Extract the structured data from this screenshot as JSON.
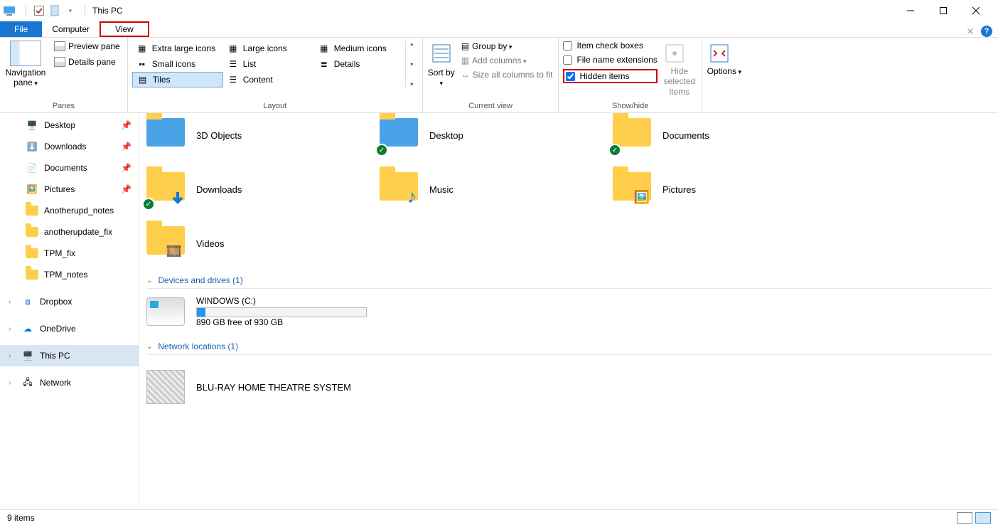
{
  "window": {
    "title": "This PC"
  },
  "ribbon_tabs": {
    "file": "File",
    "computer": "Computer",
    "view": "View"
  },
  "ribbon": {
    "panes": {
      "nav": "Navigation pane",
      "preview": "Preview pane",
      "details": "Details pane",
      "group": "Panes"
    },
    "layout": {
      "extra_large": "Extra large icons",
      "large": "Large icons",
      "medium": "Medium icons",
      "small": "Small icons",
      "list": "List",
      "details": "Details",
      "tiles": "Tiles",
      "content": "Content",
      "group": "Layout"
    },
    "current_view": {
      "sort_by": "Sort by",
      "group_by": "Group by",
      "add_columns": "Add columns",
      "size_all": "Size all columns to fit",
      "group": "Current view"
    },
    "show_hide": {
      "item_check": "Item check boxes",
      "file_ext": "File name extensions",
      "hidden": "Hidden items",
      "hide_selected": "Hide selected items",
      "group": "Show/hide"
    },
    "options": {
      "label": "Options"
    }
  },
  "nav": {
    "items": [
      {
        "label": "Desktop",
        "icon": "desktop",
        "pin": true
      },
      {
        "label": "Downloads",
        "icon": "downloads",
        "pin": true
      },
      {
        "label": "Documents",
        "icon": "documents",
        "pin": true
      },
      {
        "label": "Pictures",
        "icon": "pictures",
        "pin": true
      },
      {
        "label": "Anotherupd_notes",
        "icon": "folder",
        "pin": false
      },
      {
        "label": "anotherupdate_fix",
        "icon": "folder",
        "pin": false
      },
      {
        "label": "TPM_fix",
        "icon": "folder",
        "pin": false
      },
      {
        "label": "TPM_notes",
        "icon": "folder",
        "pin": false
      }
    ],
    "dropbox": "Dropbox",
    "onedrive": "OneDrive",
    "this_pc": "This PC",
    "network": "Network"
  },
  "content": {
    "folders_row1": [
      {
        "label": "3D Objects",
        "sync": false
      },
      {
        "label": "Desktop",
        "sync": true
      },
      {
        "label": "Documents",
        "sync": true
      }
    ],
    "folders_row2": [
      {
        "label": "Downloads",
        "sync": true
      },
      {
        "label": "Music",
        "sync": false
      },
      {
        "label": "Pictures",
        "sync": false
      }
    ],
    "folders_row3": [
      {
        "label": "Videos",
        "sync": false
      }
    ],
    "devices_header": "Devices and drives (1)",
    "drive": {
      "name": "WINDOWS (C:)",
      "free": "890 GB free of 930 GB"
    },
    "network_header": "Network locations (1)",
    "network_device": "BLU-RAY HOME THEATRE SYSTEM"
  },
  "status": {
    "items": "9 items"
  }
}
